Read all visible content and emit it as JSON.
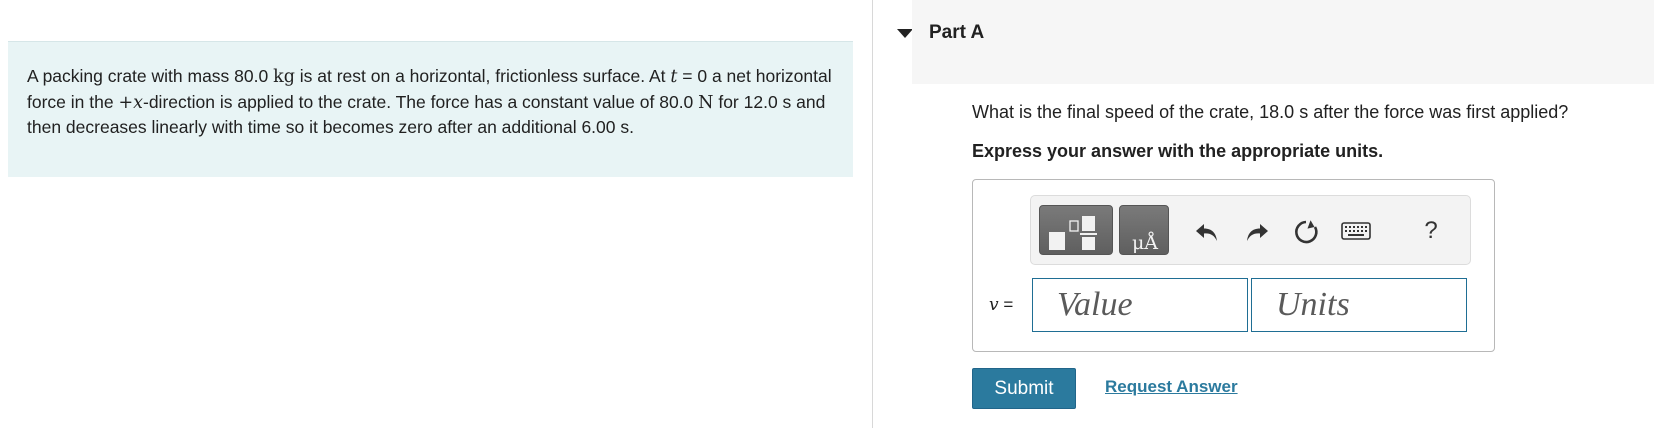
{
  "problem": {
    "seg1": "A packing crate with mass 80.0 ",
    "unit_kg": "kg",
    "seg2": " is at rest on a horizontal, frictionless surface. At ",
    "var_t": "t",
    "seg3": " = 0 a net horizontal force in the ",
    "dir": "+x",
    "seg4": "-direction is applied to the crate. The force has a constant value of 80.0 ",
    "unit_N": "N",
    "seg5": " for 12.0 s and then decreases linearly with time so it becomes zero after an additional 6.00 s."
  },
  "part": {
    "title": "Part A",
    "question": "What is the final speed of the crate, 18.0 s after the force was first applied?",
    "instruction": "Express your answer with the appropriate units."
  },
  "toolbar": {
    "template_icon": "fraction-template-icon",
    "units_icon": "units-angstrom-icon",
    "units_glyph": "μÅ",
    "undo_icon": "undo-icon",
    "redo_icon": "redo-icon",
    "reset_icon": "reset-icon",
    "keyboard_icon": "keyboard-icon",
    "help_label": "?"
  },
  "answer": {
    "variable": "v",
    "equals": " =",
    "value_placeholder": "Value",
    "units_placeholder": "Units"
  },
  "actions": {
    "submit_label": "Submit",
    "request_label": "Request Answer"
  },
  "colors": {
    "problem_bg": "#e8f4f5",
    "accent": "#2b7a9e",
    "input_border": "#1f6e94"
  }
}
